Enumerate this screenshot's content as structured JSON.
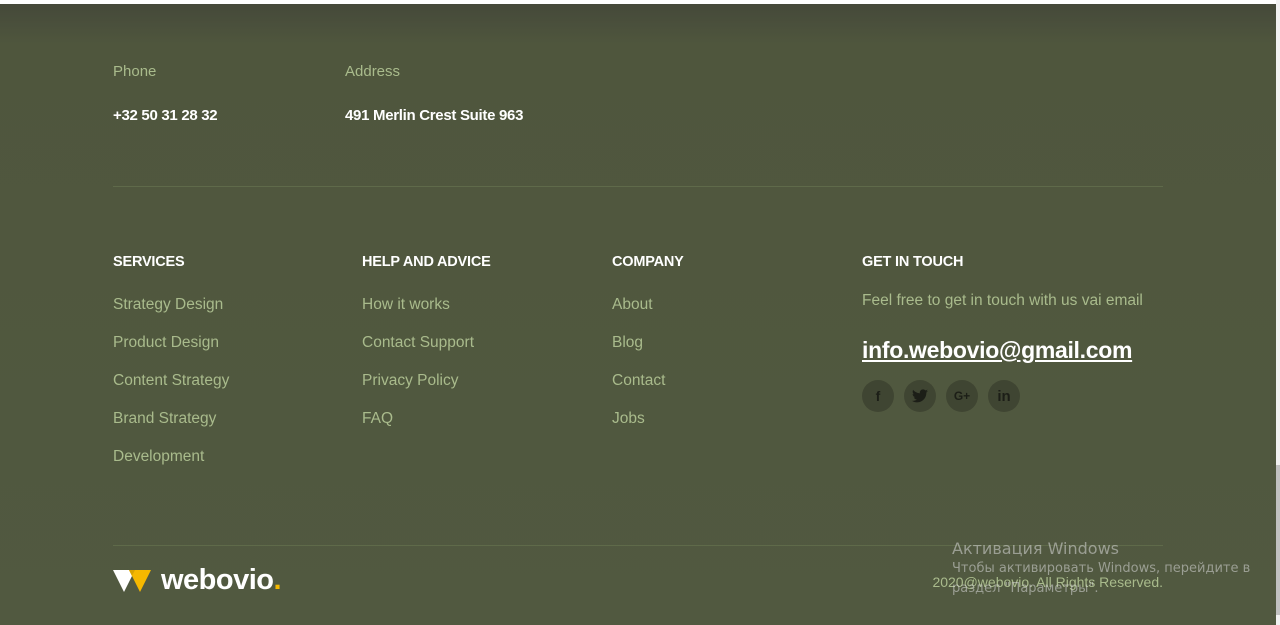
{
  "contact": {
    "phone_label": "Phone",
    "phone_value": "+32 50 31 28 32",
    "address_label": "Address",
    "address_value": "491 Merlin Crest Suite 963"
  },
  "columns": {
    "services": {
      "title": "SERVICES",
      "items": [
        "Strategy Design",
        "Product Design",
        "Content Strategy",
        "Brand Strategy",
        "Development"
      ]
    },
    "help": {
      "title": "HELP AND ADVICE",
      "items": [
        "How it works",
        "Contact Support",
        "Privacy Policy",
        "FAQ"
      ]
    },
    "company": {
      "title": "COMPANY",
      "items": [
        "About",
        "Blog",
        "Contact",
        "Jobs"
      ]
    },
    "touch": {
      "title": "GET IN TOUCH",
      "text": "Feel free to get in touch with us vai email",
      "email": "info.webovio@gmail.com",
      "socials": [
        {
          "icon": "facebook-icon",
          "glyph": "f"
        },
        {
          "icon": "twitter-icon",
          "glyph": "🐦"
        },
        {
          "icon": "google-plus-icon",
          "glyph": "G+"
        },
        {
          "icon": "linkedin-icon",
          "glyph": "in"
        }
      ]
    }
  },
  "footer": {
    "logo_text": "webovio",
    "logo_dot": ".",
    "copyright": "2020@webovio. All Rights Reserved."
  },
  "watermark": {
    "title": "Активация Windows",
    "text": "Чтобы активировать Windows, перейдите в раздел \"Параметры\"."
  },
  "colors": {
    "background": "#515940",
    "accent_text": "#a9bb8c",
    "logo_accent": "#f5b800"
  }
}
